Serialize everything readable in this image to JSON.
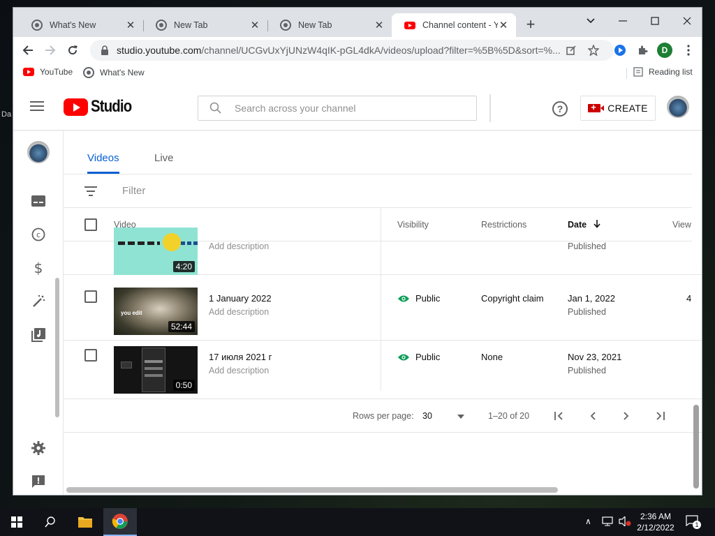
{
  "browser": {
    "tabs": [
      {
        "label": "What's New",
        "active": false
      },
      {
        "label": "New Tab",
        "active": false
      },
      {
        "label": "New Tab",
        "active": false
      },
      {
        "label": "Channel content - Yo",
        "active": true
      }
    ],
    "url_host": "studio.youtube.com",
    "url_path": "/channel/UCGvUxYjUNzW4qIK-pGL4dkA/videos/upload?filter=%5B%5D&sort=%...",
    "profile_initial": "D",
    "bookmarks": [
      {
        "label": "YouTube",
        "icon": "youtube-icon"
      },
      {
        "label": "What's New",
        "icon": "chrome-icon"
      }
    ],
    "reading_list": "Reading list"
  },
  "studio": {
    "logo_text": "Studio",
    "search_placeholder": "Search across your channel",
    "create_label": "CREATE",
    "help_glyph": "?",
    "tabs": [
      {
        "label": "Videos",
        "active": true
      },
      {
        "label": "Live",
        "active": false
      }
    ],
    "filter_placeholder": "Filter",
    "columns": {
      "video": "Video",
      "visibility": "Visibility",
      "restrictions": "Restrictions",
      "date": "Date",
      "views": "View"
    },
    "rows": [
      {
        "title": "",
        "description": "Add description",
        "duration": "4:20",
        "visibility": "",
        "restrictions": "",
        "date": "",
        "status": "Published",
        "views": ""
      },
      {
        "title": "1 January 2022",
        "description": "Add description",
        "duration": "52:44",
        "visibility": "Public",
        "restrictions": "Copyright claim",
        "date": "Jan 1, 2022",
        "status": "Published",
        "views": "4"
      },
      {
        "title": "17 июля 2021 г",
        "description": "Add description",
        "duration": "0:50",
        "visibility": "Public",
        "restrictions": "None",
        "date": "Nov 23, 2021",
        "status": "Published",
        "views": ""
      }
    ],
    "thumb_caption": "you edit",
    "pagination": {
      "rows_label": "Rows per page:",
      "rows_value": "30",
      "range": "1–20 of 20"
    }
  },
  "taskbar": {
    "time": "2:36 AM",
    "date": "2/12/2022",
    "notification_count": "1"
  },
  "colors": {
    "accent_blue": "#065fd4",
    "youtube_red": "#ff0000",
    "public_green": "#0f9d58"
  }
}
